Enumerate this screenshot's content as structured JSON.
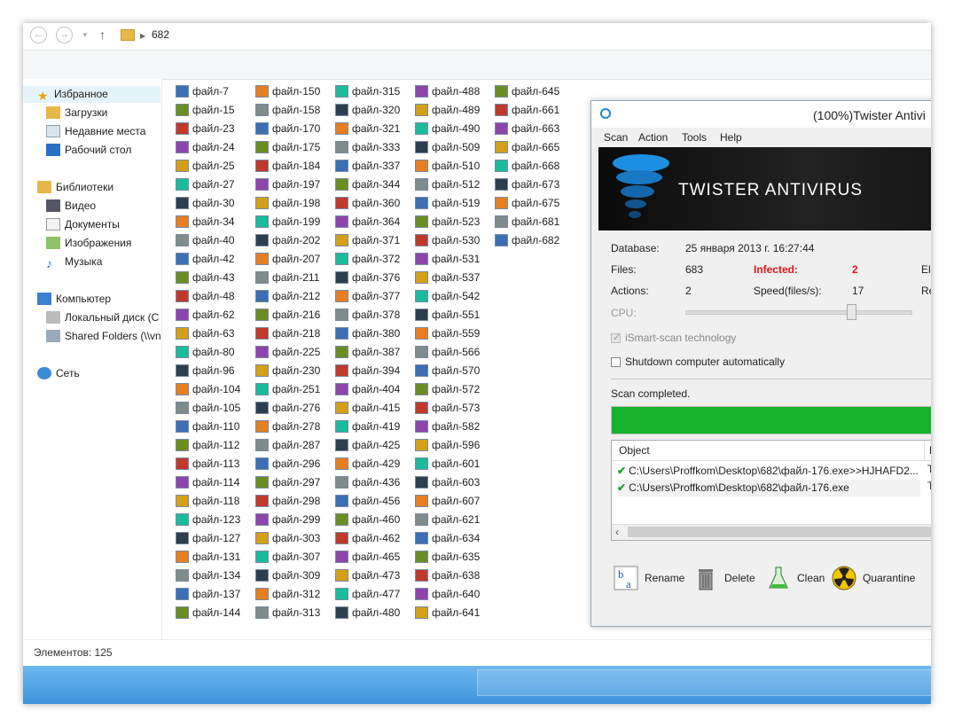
{
  "explorer": {
    "path": "682",
    "nav": {
      "favorites": "Избранное",
      "downloads": "Загрузки",
      "recent": "Недавние места",
      "desktop": "Рабочий стол",
      "libraries": "Библиотеки",
      "video": "Видео",
      "documents": "Документы",
      "images": "Изображения",
      "music": "Музыка",
      "computer": "Компьютер",
      "local_disk": "Локальный диск (C",
      "shared": "Shared Folders (\\\\vn",
      "network": "Сеть"
    },
    "files": [
      [
        "файл-7",
        "файл-15",
        "файл-23",
        "файл-24",
        "файл-25",
        "файл-27",
        "файл-30",
        "файл-34",
        "файл-40",
        "файл-42",
        "файл-43",
        "файл-48",
        "файл-62",
        "файл-63",
        "файл-80",
        "файл-96",
        "файл-104",
        "файл-105",
        "файл-110",
        "файл-112",
        "файл-113",
        "файл-114",
        "файл-118",
        "файл-123",
        "файл-127",
        "файл-131",
        "файл-134",
        "файл-137",
        "файл-144"
      ],
      [
        "файл-150",
        "файл-158",
        "файл-170",
        "файл-175",
        "файл-184",
        "файл-197",
        "файл-198",
        "файл-199",
        "файл-202",
        "файл-207",
        "файл-211",
        "файл-212",
        "файл-216",
        "файл-218",
        "файл-225",
        "файл-230",
        "файл-251",
        "файл-276",
        "файл-278",
        "файл-287",
        "файл-296",
        "файл-297",
        "файл-298",
        "файл-299",
        "файл-303",
        "файл-307",
        "файл-309",
        "файл-312",
        "файл-313"
      ],
      [
        "файл-315",
        "файл-320",
        "файл-321",
        "файл-333",
        "файл-337",
        "файл-344",
        "файл-360",
        "файл-364",
        "файл-371",
        "файл-372",
        "файл-376",
        "файл-377",
        "файл-378",
        "файл-380",
        "файл-387",
        "файл-394",
        "файл-404",
        "файл-415",
        "файл-419",
        "файл-425",
        "файл-429",
        "файл-436",
        "файл-456",
        "файл-460",
        "файл-462",
        "файл-465",
        "файл-473",
        "файл-477",
        "файл-480"
      ],
      [
        "файл-488",
        "файл-489",
        "файл-490",
        "файл-509",
        "файл-510",
        "файл-512",
        "файл-519",
        "файл-523",
        "файл-530",
        "файл-531",
        "файл-537",
        "файл-542",
        "файл-551",
        "файл-559",
        "файл-566",
        "файл-570",
        "файл-572",
        "файл-573",
        "файл-582",
        "файл-596",
        "файл-601",
        "файл-603",
        "файл-607",
        "файл-621",
        "файл-634",
        "файл-635",
        "файл-638",
        "файл-640",
        "файл-641"
      ],
      [
        "файл-645",
        "файл-661",
        "файл-663",
        "файл-665",
        "файл-668",
        "файл-673",
        "файл-675",
        "файл-681",
        "файл-682"
      ]
    ],
    "status": "Элементов: 125"
  },
  "antivirus": {
    "title": "(100%)Twister Antivi",
    "menu": [
      "Scan",
      "Action",
      "Tools",
      "Help"
    ],
    "logo_text": "TWISTER ANTIVIRUS",
    "database_label": "Database:",
    "database_value": "25 января 2013 г. 16:27:44",
    "files_label": "Files:",
    "files_value": "683",
    "infected_label": "Infected:",
    "infected_value": "2",
    "elapsed_label_partial": "Ela",
    "actions_label": "Actions:",
    "actions_value": "2",
    "speed_label": "Speed(files/s):",
    "speed_value": "17",
    "remaining_label_partial": "Re",
    "cpu_label": "CPU:",
    "cpu_level": 0.73,
    "ismart_label": "iSmart-scan technology",
    "ismart_checked": true,
    "shutdown_label": "Shutdown computer automatically",
    "shutdown_checked": false,
    "scan_status": "Scan completed.",
    "progress": 1.0,
    "progress_color": "#14b22b",
    "list_header_object": "Object",
    "list_header_second": "N",
    "results": [
      {
        "object": "C:\\Users\\Proffkom\\Desktop\\682\\файл-176.exe>>HJHAFD2...",
        "second": "T"
      },
      {
        "object": "C:\\Users\\Proffkom\\Desktop\\682\\файл-176.exe",
        "second": "T"
      }
    ],
    "buttons": {
      "rename": "Rename",
      "delete": "Delete",
      "clean": "Clean",
      "quarantine": "Quarantine"
    }
  }
}
